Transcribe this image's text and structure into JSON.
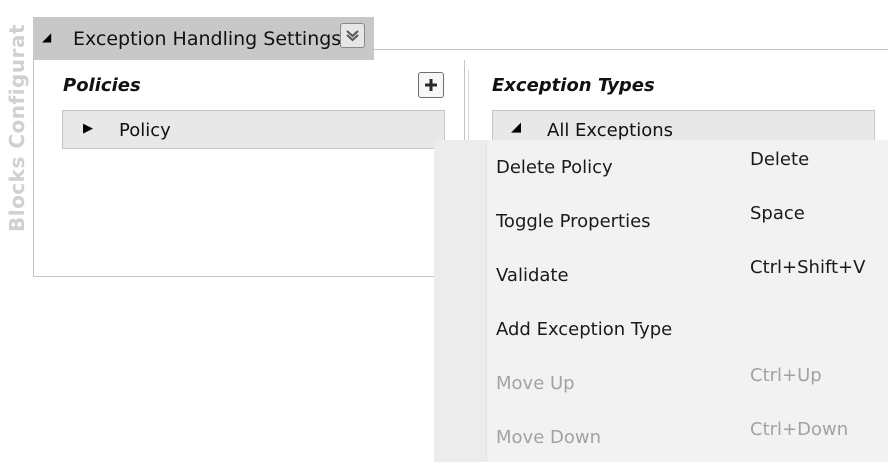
{
  "side_label": "Blocks Configurat",
  "section": {
    "title": "Exception Handling Settings",
    "expand_icon": "triangle-down-icon",
    "collapse_icon": "double-chevron-down-icon"
  },
  "policies": {
    "title": "Policies",
    "add_icon": "plus-icon",
    "items": [
      {
        "label": "Policy",
        "icon": "triangle-right-icon"
      }
    ]
  },
  "exception_types": {
    "title": "Exception Types",
    "items": [
      {
        "label": "All Exceptions",
        "icon": "triangle-down-icon"
      }
    ]
  },
  "context_menu": {
    "items": [
      {
        "label": "Delete Policy",
        "shortcut": "Delete",
        "enabled": true
      },
      {
        "label": "Toggle Properties",
        "shortcut": "Space",
        "enabled": true
      },
      {
        "label": "Validate",
        "shortcut": "Ctrl+Shift+V",
        "enabled": true
      },
      {
        "label": "Add Exception Type",
        "shortcut": "",
        "enabled": true
      },
      {
        "label": "Move Up",
        "shortcut": "Ctrl+Up",
        "enabled": false
      },
      {
        "label": "Move Down",
        "shortcut": "Ctrl+Down",
        "enabled": false
      }
    ]
  }
}
